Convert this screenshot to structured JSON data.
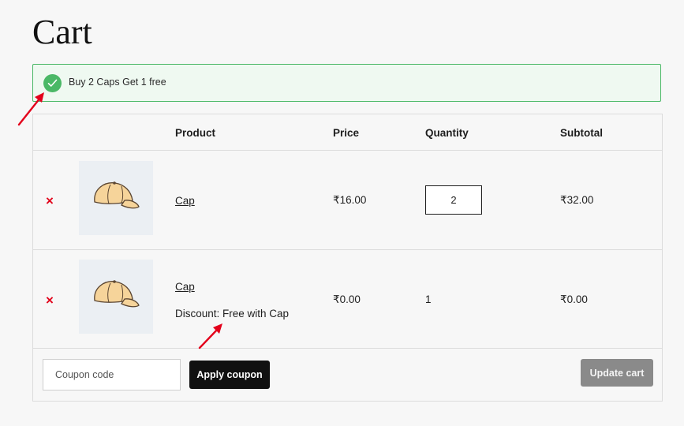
{
  "page": {
    "title": "Cart"
  },
  "notice": {
    "text": "Buy 2 Caps Get 1 free",
    "icon": "check-circle-icon",
    "accent_color": "#4ab866"
  },
  "table": {
    "headers": {
      "product": "Product",
      "price": "Price",
      "quantity": "Quantity",
      "subtotal": "Subtotal"
    },
    "rows": [
      {
        "name": "Cap",
        "price": "₹16.00",
        "quantity": "2",
        "subtotal": "₹32.00",
        "remove_symbol": "×",
        "image_icon": "cap-icon"
      },
      {
        "name": "Cap",
        "meta": "Discount: Free with Cap",
        "price": "₹0.00",
        "quantity": "1",
        "subtotal": "₹0.00",
        "remove_symbol": "×",
        "image_icon": "cap-icon"
      }
    ]
  },
  "actions": {
    "coupon_placeholder": "Coupon code",
    "apply_label": "Apply coupon",
    "update_label": "Update cart"
  },
  "colors": {
    "remove": "#e2001b",
    "annotation_arrow": "#e3001b",
    "button_dark": "#111111",
    "button_disabled": "#8a8a8a"
  }
}
